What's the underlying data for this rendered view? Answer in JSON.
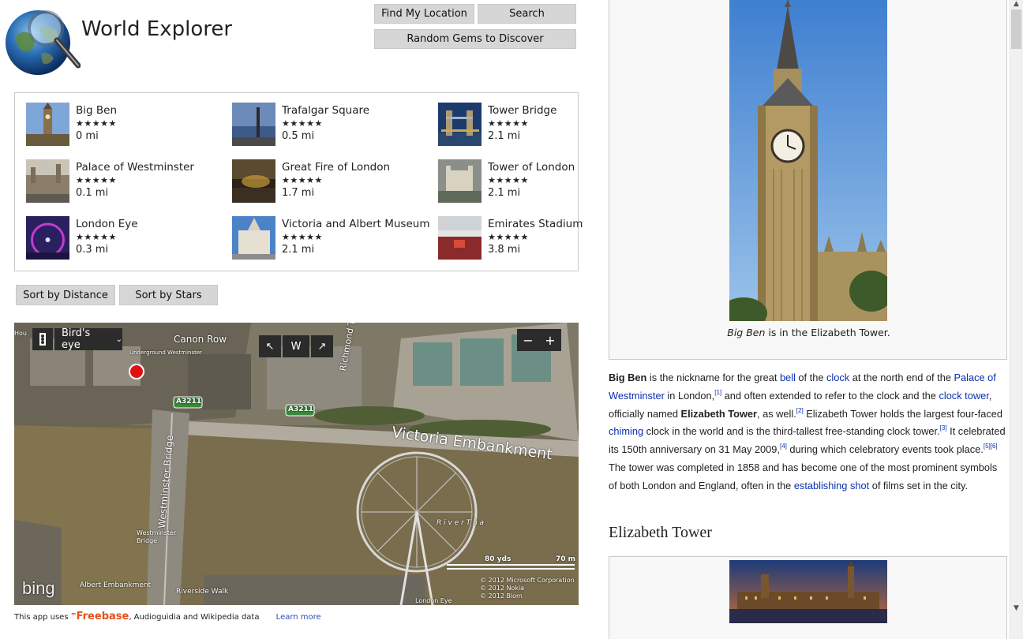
{
  "app": {
    "title": "World Explorer",
    "logo_icon": "globe-magnifier-icon"
  },
  "toolbar": {
    "find_location_label": "Find My Location",
    "search_label": "Search",
    "random_gems_label": "Random Gems to Discover"
  },
  "places": [
    {
      "name": "Big Ben",
      "stars": "★★★★★",
      "rating": 5,
      "distance": "0 mi"
    },
    {
      "name": "Trafalgar Square",
      "stars": "★★★★★",
      "rating": 5,
      "distance": "0.5 mi"
    },
    {
      "name": "Tower Bridge",
      "stars": "★★★★★",
      "rating": 5,
      "distance": "2.1 mi"
    },
    {
      "name": "Palace of Westminster",
      "stars": "★★★★★",
      "rating": 5,
      "distance": "0.1 mi"
    },
    {
      "name": "Great Fire of London",
      "stars": "★★★★★",
      "rating": 5,
      "distance": "1.7 mi"
    },
    {
      "name": "Tower of London",
      "stars": "★★★★★",
      "rating": 5,
      "distance": "2.1 mi"
    },
    {
      "name": "London Eye",
      "stars": "★★★★★",
      "rating": 5,
      "distance": "0.3 mi"
    },
    {
      "name": "Victoria and Albert Museum",
      "stars": "★★★★★",
      "rating": 5,
      "distance": "2.1 mi"
    },
    {
      "name": "Emirates Stadium",
      "stars": "★★★★★",
      "rating": 5,
      "distance": "3.8 mi"
    }
  ],
  "sort": {
    "distance_label": "Sort by Distance",
    "stars_label": "Sort by Stars"
  },
  "map": {
    "view_mode": "Bird's eye",
    "compass_direction": "W",
    "zoom_out": "−",
    "zoom_in": "+",
    "scale_yds": "80 yds",
    "scale_m": "70 m",
    "copyright": [
      "© 2012 Microsoft Corporation",
      "© 2012 Nokia",
      "© 2012 Blom"
    ],
    "brand": "bing",
    "labels": {
      "victoria_embankment": "Victoria Embankment",
      "westminster_bridge": "Westminster Bridge",
      "richmond_terrace": "Richmond Terrace",
      "canon_row": "Canon Row",
      "a3211_a": "A3211",
      "a3211_b": "A3211",
      "underground": "Underground Westminster",
      "westminster_bridge_small": "Westminster Bridge",
      "albert_embankment": "Albert Embankment",
      "riverside_walk": "Riverside Walk",
      "london_eye": "London Eye",
      "river": "R i v e r   T h a",
      "hou": "Hou"
    }
  },
  "footer": {
    "prefix": "This app uses",
    "freebase": "Freebase",
    "rest": ", Audioguidia and Wikipedia data",
    "learn_more": "Learn more"
  },
  "article": {
    "caption_italic": "Big Ben",
    "caption_rest": " is in the Elizabeth Tower.",
    "section_title": "Elizabeth Tower"
  },
  "colors": {
    "button_bg": "#d6d6d6",
    "link": "#0b2fb0",
    "freebase": "#e2521d",
    "learn_more": "#2a4bb8"
  }
}
